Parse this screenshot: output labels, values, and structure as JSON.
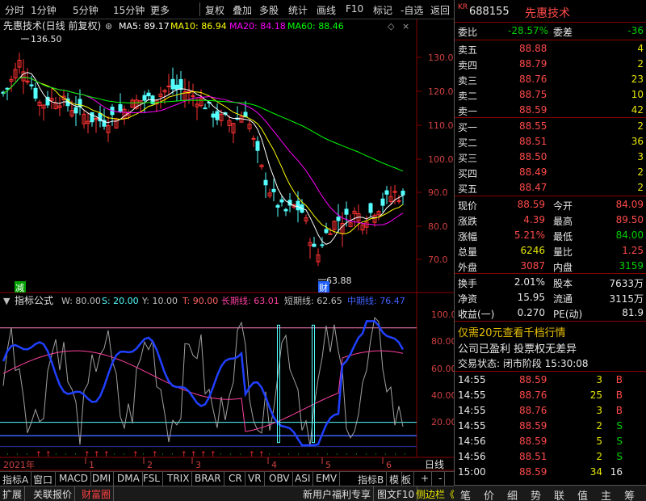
{
  "toolbar": {
    "items": [
      "分时",
      "1分钟",
      "5分钟",
      "15分钟",
      "更多",
      "复权",
      "叠加",
      "多股",
      "统计",
      "画线",
      "F10",
      "标记",
      "-自选",
      "返回"
    ]
  },
  "main_chart": {
    "stock_label": "先惠技术",
    "mode": "(日线 前复权)",
    "ma": [
      {
        "label": "MA5: 89.17",
        "color": "#ffffff"
      },
      {
        "label": "MA10: 86.94",
        "color": "#ffff00"
      },
      {
        "label": "MA20: 84.18",
        "color": "#ff00ff"
      },
      {
        "label": "MA60: 88.46",
        "color": "#00ff00"
      }
    ],
    "high_label": "136.50",
    "low_label": "63.88",
    "marker_jian": "减",
    "marker_cai": "财",
    "y_ticks": [
      "130.0",
      "120.0",
      "110.0",
      "100.0",
      "90.0",
      "80.0",
      "70.0"
    ],
    "up_color": "#ff3232",
    "down_color": "#54ffff"
  },
  "indicator": {
    "name": "指标公式",
    "params": [
      {
        "label": "W: 80.00",
        "color": "#c0c0c0"
      },
      {
        "label": "S: 20.00",
        "color": "#54ffff"
      },
      {
        "label": "Y: 10.00",
        "color": "#c0c0c0"
      },
      {
        "label": "T: 90.00",
        "color": "#ff6464"
      },
      {
        "label": "长期线: 63.01",
        "color": "#ff40a0"
      },
      {
        "label": "短期线: 62.65",
        "color": "#c0c0c0"
      },
      {
        "label": "中期线: 76.47",
        "color": "#4060ff"
      }
    ],
    "y_ticks": [
      "100.0",
      "80.00",
      "60.00",
      "40.00",
      "20.00"
    ]
  },
  "date_axis": {
    "year_label": "2021年",
    "months": [
      "1",
      "2",
      "3",
      "4",
      "5",
      "6"
    ],
    "period": "日线"
  },
  "indicator_tabs": [
    "指标A",
    "窗口",
    "MACD",
    "DMI",
    "DMA",
    "FSL",
    "TRIX",
    "BRAR",
    "CR",
    "VR",
    "OBV",
    "ASI",
    "EMV"
  ],
  "right_tabs_small": [
    "指标B",
    "模",
    "板",
    "+",
    "-"
  ],
  "bottom_tabs": {
    "left": [
      "扩展",
      "关联报价",
      "财富圈"
    ],
    "right": [
      "新用户福利专享",
      "图文F10",
      "侧边栏《"
    ]
  },
  "quote": {
    "market": "KR",
    "code": "688155",
    "name": "先惠技术",
    "weibi_label": "委比",
    "weibi": "-28.57%",
    "weicha_label": "委差",
    "weicha": "-36",
    "asks": [
      {
        "label": "卖五",
        "price": "88.88",
        "vol": "4"
      },
      {
        "label": "卖四",
        "price": "88.79",
        "vol": "2"
      },
      {
        "label": "卖三",
        "price": "88.76",
        "vol": "23"
      },
      {
        "label": "卖二",
        "price": "88.75",
        "vol": "10"
      },
      {
        "label": "卖一",
        "price": "88.59",
        "vol": "42"
      }
    ],
    "bids": [
      {
        "label": "买一",
        "price": "88.55",
        "vol": "2"
      },
      {
        "label": "买二",
        "price": "88.51",
        "vol": "36"
      },
      {
        "label": "买三",
        "price": "88.50",
        "vol": "3"
      },
      {
        "label": "买四",
        "price": "88.49",
        "vol": "2"
      },
      {
        "label": "买五",
        "price": "88.47",
        "vol": "2"
      }
    ],
    "stats": [
      {
        "l1": "现价",
        "v1": "88.59",
        "c1": "red",
        "l2": "今开",
        "v2": "84.09",
        "c2": "red"
      },
      {
        "l1": "涨跌",
        "v1": "4.39",
        "c1": "red",
        "l2": "最高",
        "v2": "89.50",
        "c2": "red"
      },
      {
        "l1": "涨幅",
        "v1": "5.21%",
        "c1": "red",
        "l2": "最低",
        "v2": "84.00",
        "c2": "green"
      },
      {
        "l1": "总量",
        "v1": "6246",
        "c1": "yellow",
        "l2": "量比",
        "v2": "1.25",
        "c2": "red"
      },
      {
        "l1": "外盘",
        "v1": "3087",
        "c1": "red",
        "l2": "内盘",
        "v2": "3159",
        "c2": "green"
      }
    ],
    "stats2": [
      {
        "l1": "换手",
        "v1": "2.01%",
        "l2": "股本",
        "v2": "7633万"
      },
      {
        "l1": "净资",
        "v1": "15.95",
        "l2": "流通",
        "v2": "3115万"
      },
      {
        "l1": "收益(一)",
        "v1": "0.270",
        "l2": "PE(动)",
        "v2": "81.9"
      }
    ],
    "promo": "仅需20元查看千档行情",
    "notice": "公司已盈利 投票权无差异",
    "status": "交易状态: 闭市阶段 15:30:08",
    "ticks": [
      {
        "time": "14:55",
        "price": "88.59",
        "vol": "3",
        "side": "B"
      },
      {
        "time": "14:55",
        "price": "88.76",
        "vol": "25",
        "side": "B"
      },
      {
        "time": "14:55",
        "price": "88.76",
        "vol": "3",
        "side": "B"
      },
      {
        "time": "14:55",
        "price": "88.59",
        "vol": "2",
        "side": "S"
      },
      {
        "time": "14:56",
        "price": "88.59",
        "vol": "5",
        "side": "S"
      },
      {
        "time": "14:56",
        "price": "88.51",
        "vol": "2",
        "side": "S"
      },
      {
        "time": "15:00",
        "price": "88.59",
        "vol": "34",
        "side": "16"
      }
    ],
    "side_tabs": [
      "笔",
      "价",
      "细",
      "势",
      "联",
      "值",
      "主",
      "筹"
    ]
  }
}
